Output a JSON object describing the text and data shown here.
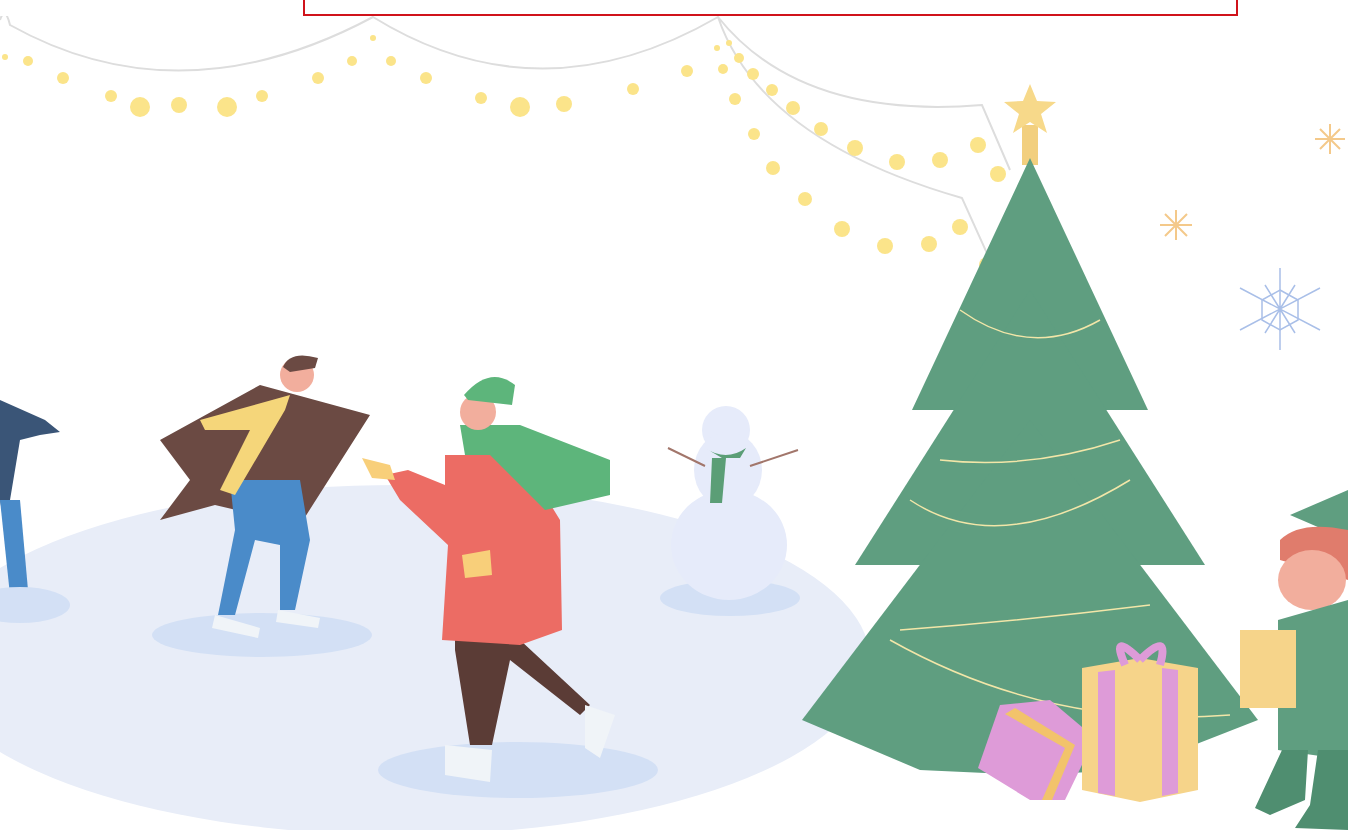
{
  "notice_box": {
    "shown": true
  },
  "illustration": {
    "shown": true
  }
}
